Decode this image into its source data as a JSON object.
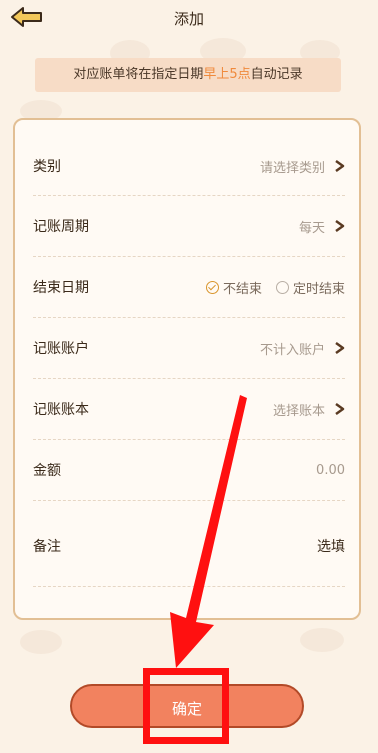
{
  "header": {
    "title": "添加"
  },
  "notice": {
    "prefix": "对应账单将在指定日期",
    "highlight": "早上5点",
    "suffix": "自动记录"
  },
  "form": {
    "category": {
      "label": "类别",
      "value": "请选择类别"
    },
    "cycle": {
      "label": "记账周期",
      "value": "每天"
    },
    "end_date": {
      "label": "结束日期",
      "option_1": "不结束",
      "option_2": "定时结束",
      "selected": "不结束"
    },
    "account": {
      "label": "记账账户",
      "value": "不计入账户"
    },
    "book": {
      "label": "记账账本",
      "value": "选择账本"
    },
    "amount": {
      "label": "金额",
      "value": "0.00"
    },
    "note": {
      "label": "备注",
      "value": "选填"
    }
  },
  "confirm": {
    "label": "确定"
  },
  "colors": {
    "accent": "#f2825f",
    "highlight_text": "#f08a3c",
    "annotation": "#ff1010"
  }
}
